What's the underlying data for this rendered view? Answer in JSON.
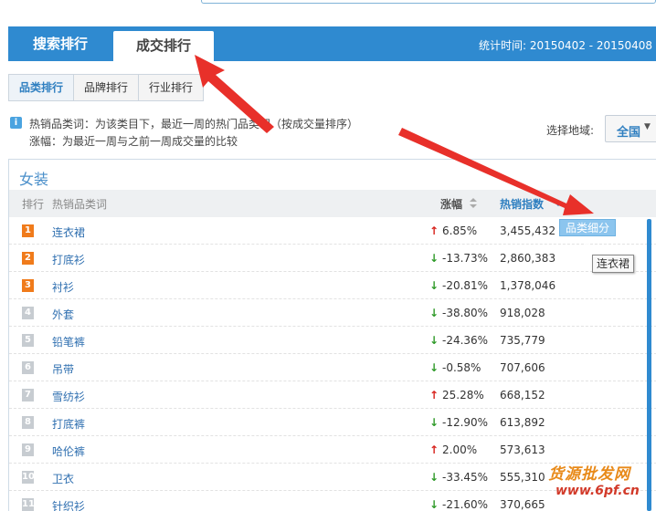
{
  "tabs": [
    {
      "label": "搜索排行",
      "active": false
    },
    {
      "label": "成交排行",
      "active": true
    }
  ],
  "stat_time": "统计时间: 20150402 - 20150408",
  "subtabs": [
    {
      "label": "品类排行",
      "active": true
    },
    {
      "label": "品牌排行",
      "active": false
    },
    {
      "label": "行业排行",
      "active": false
    }
  ],
  "info": {
    "icon": "info-icon",
    "line1": "热销品类词：为该类目下，最近一周的热门品类词（按成交量排序）",
    "line2": "涨幅：为最近一周与之前一周成交量的比较"
  },
  "region": {
    "label": "选择地域:",
    "value": "全国"
  },
  "category_title": "女装",
  "table": {
    "headers": {
      "rank": "排行",
      "word": "热销品类词",
      "change": "涨幅",
      "index": "热销指数"
    },
    "rows": [
      {
        "rank": "1",
        "word": "连衣裙",
        "dir": "up",
        "change": "6.85%",
        "index": "3,455,432"
      },
      {
        "rank": "2",
        "word": "打底衫",
        "dir": "down",
        "change": "-13.73%",
        "index": "2,860,383"
      },
      {
        "rank": "3",
        "word": "衬衫",
        "dir": "down",
        "change": "-20.81%",
        "index": "1,378,046"
      },
      {
        "rank": "4",
        "word": "外套",
        "dir": "down",
        "change": "-38.80%",
        "index": "918,028"
      },
      {
        "rank": "5",
        "word": "铅笔裤",
        "dir": "down",
        "change": "-24.36%",
        "index": "735,779"
      },
      {
        "rank": "6",
        "word": "吊带",
        "dir": "down",
        "change": "-0.58%",
        "index": "707,606"
      },
      {
        "rank": "7",
        "word": "雪纺衫",
        "dir": "up",
        "change": "25.28%",
        "index": "668,152"
      },
      {
        "rank": "8",
        "word": "打底裤",
        "dir": "down",
        "change": "-12.90%",
        "index": "613,892"
      },
      {
        "rank": "9",
        "word": "哈伦裤",
        "dir": "up",
        "change": "2.00%",
        "index": "573,613"
      },
      {
        "rank": "10",
        "word": "卫衣",
        "dir": "down",
        "change": "-33.45%",
        "index": "555,310"
      },
      {
        "rank": "11",
        "word": "针织衫",
        "dir": "down",
        "change": "-21.60%",
        "index": "370,665"
      }
    ]
  },
  "detail_button": "品类细分 >",
  "tooltip": "连衣裙",
  "watermark": {
    "line1": "货源批发网",
    "line2": "www.6pf.cn"
  },
  "colors": {
    "accent": "#2f8ad0",
    "up": "#d7211b",
    "down": "#2f9a29",
    "rank_top": "#f07b1b",
    "rank_other": "#c7ccd1",
    "annotation_arrow": "#e8302a"
  }
}
